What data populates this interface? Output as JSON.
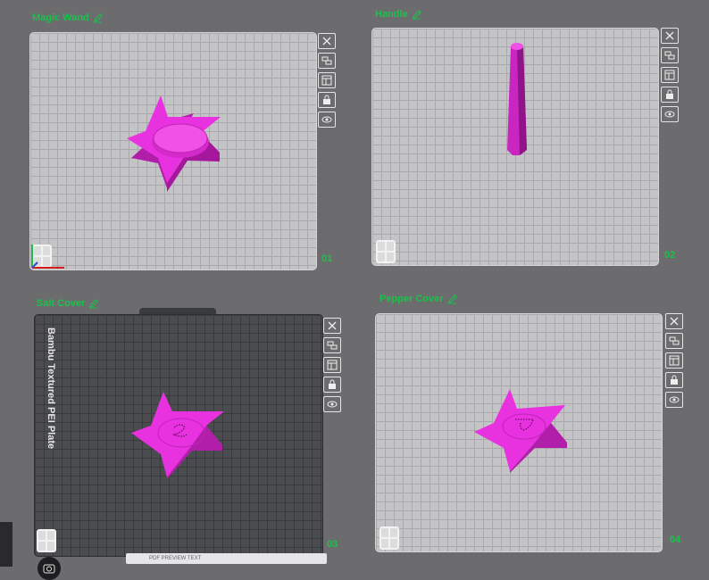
{
  "plates": [
    {
      "title": "Magic Wand",
      "number": "01"
    },
    {
      "title": "Handle",
      "number": "02"
    },
    {
      "title": "Salt Cover",
      "number": "03",
      "bed_label": "Bambu Textured PEI Plate"
    },
    {
      "title": "Pepper Cover",
      "number": "04"
    }
  ],
  "toolbar_icons": [
    "close-icon",
    "arrange-icon",
    "layout-icon",
    "lock-icon",
    "eye-icon"
  ],
  "colors": {
    "accent": "#19c24a",
    "model": "#e832e0",
    "background": "#6c6c6f"
  },
  "footer": {
    "search_text": "PDF PREVIEW TEXT"
  }
}
